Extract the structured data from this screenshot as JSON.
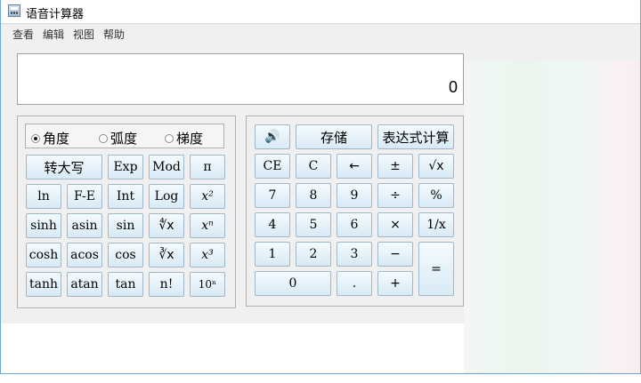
{
  "window": {
    "title": "语音计算器"
  },
  "menu": [
    "查看",
    "编辑",
    "视图",
    "帮助"
  ],
  "display": {
    "value": "0"
  },
  "angle_modes": [
    {
      "label": "角度",
      "selected": true
    },
    {
      "label": "弧度",
      "selected": false
    },
    {
      "label": "梯度",
      "selected": false
    }
  ],
  "sci_buttons": {
    "to_upper": "转大写",
    "exp": "Exp",
    "mod": "Mod",
    "pi": "π",
    "ln": "ln",
    "fe": "F-E",
    "int": "Int",
    "log": "Log",
    "x_sq": "x²",
    "sinh": "sinh",
    "asin": "asin",
    "sin": "sin",
    "root_y": "∜x",
    "x_n": "xⁿ",
    "cosh": "cosh",
    "acos": "acos",
    "cos": "cos",
    "cube_root": "∛x",
    "x_cube": "x³",
    "tanh": "tanh",
    "atan": "atan",
    "tan": "tan",
    "factorial": "n!",
    "ten_n": "10ⁿ"
  },
  "std_buttons": {
    "speaker": "🔊",
    "memory": "存储",
    "expression": "表达式计算",
    "ce": "CE",
    "c": "C",
    "backspace": "←",
    "plus_minus": "±",
    "sqrt": "√x",
    "n7": "7",
    "n8": "8",
    "n9": "9",
    "divide": "÷",
    "percent": "%",
    "n4": "4",
    "n5": "5",
    "n6": "6",
    "multiply": "×",
    "reciprocal": "1/x",
    "n1": "1",
    "n2": "2",
    "n3": "3",
    "minus": "−",
    "equals": "=",
    "n0": "0",
    "dot": ".",
    "plus": "+"
  }
}
